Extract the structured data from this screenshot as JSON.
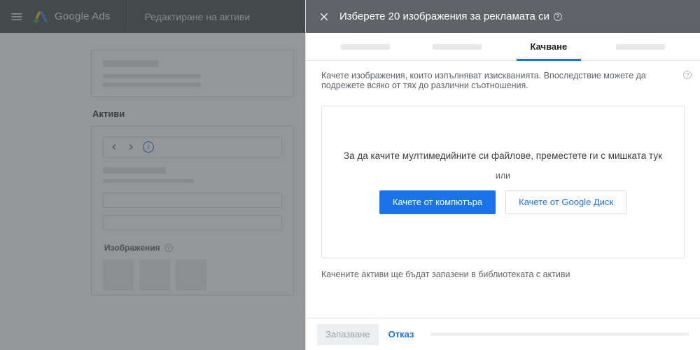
{
  "header": {
    "brand": "Google Ads",
    "page_title": "Редактиране на активи"
  },
  "background": {
    "section_assets": "Активи",
    "section_images": "Изображения"
  },
  "panel": {
    "title": "Изберете 20 изображения за рекламата си",
    "tabs": {
      "active_label": "Качване"
    },
    "instructions": "Качете изображения, които изпълняват изискванията. Впоследствие можете да подрежете всяко от тях до различни съотношения.",
    "dropzone": {
      "drag_text": "За да качите мултимедийните си файлове, преместете ги с мишката тук",
      "or": "или",
      "upload_computer": "Качете от компютъра",
      "upload_drive": "Качете от Google Диск"
    },
    "note": "Качените активи ще бъдат запазени в библиотеката с активи",
    "footer": {
      "save": "Запазване",
      "cancel": "Отказ"
    }
  }
}
